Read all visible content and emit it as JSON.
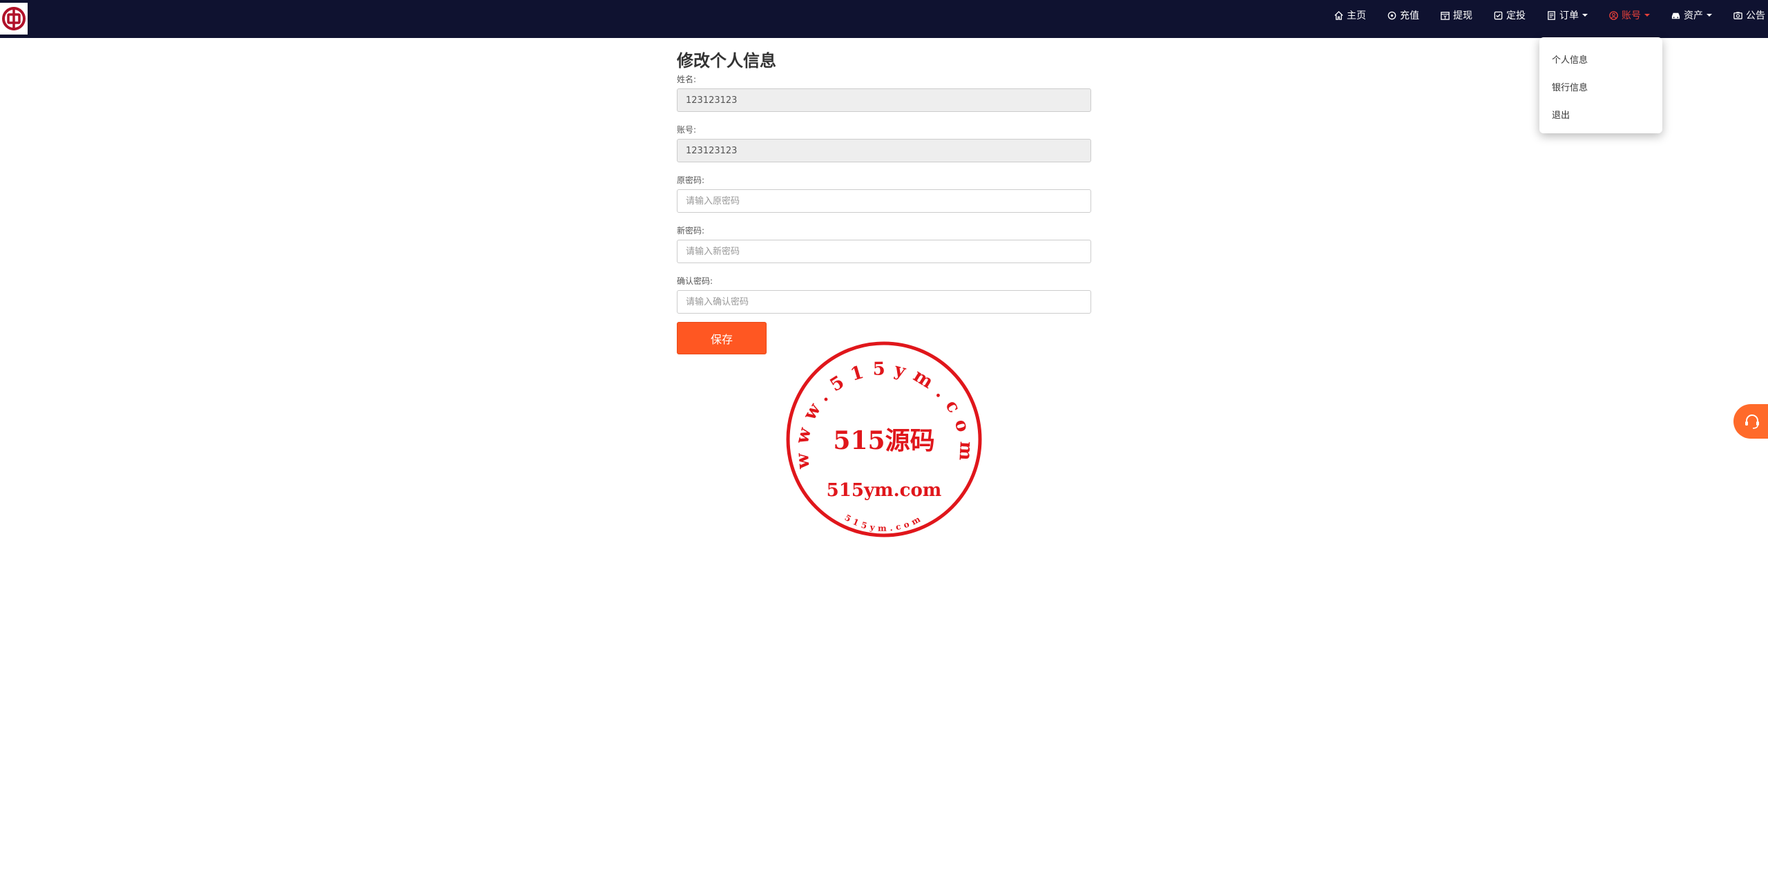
{
  "nav": {
    "items": [
      {
        "label": "主页",
        "icon": "home-icon"
      },
      {
        "label": "充值",
        "icon": "recharge-icon"
      },
      {
        "label": "提现",
        "icon": "withdraw-icon"
      },
      {
        "label": "定投",
        "icon": "invest-icon"
      },
      {
        "label": "订单",
        "icon": "order-icon",
        "dropdown": true
      },
      {
        "label": "账号",
        "icon": "user-icon",
        "dropdown": true,
        "active": true
      },
      {
        "label": "资产",
        "icon": "assets-icon",
        "dropdown": true
      },
      {
        "label": "公告",
        "icon": "notice-icon"
      }
    ]
  },
  "account_menu": {
    "items": [
      "个人信息",
      "银行信息",
      "退出"
    ]
  },
  "form": {
    "title": "修改个人信息",
    "name_label": "姓名:",
    "name_value": "123123123",
    "account_label": "账号:",
    "account_value": "123123123",
    "old_password_label": "原密码:",
    "old_password_placeholder": "请输入原密码",
    "new_password_label": "新密码:",
    "new_password_placeholder": "请输入新密码",
    "confirm_password_label": "确认密码:",
    "confirm_password_placeholder": "请输入确认密码",
    "save_label": "保存"
  },
  "watermark": {
    "ring_text": "www.515ym.com",
    "center_text": "515源码",
    "domain_text": "515ym.com",
    "bottom_text": "515ym.com",
    "color": "#e0161b"
  },
  "colors": {
    "topbar": "#0f1230",
    "accent": "#ff5722",
    "active_nav": "#e8413a"
  }
}
